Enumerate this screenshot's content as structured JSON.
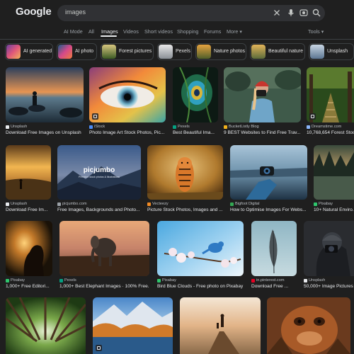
{
  "header": {
    "logo": "Google",
    "search_value": "images"
  },
  "tabs": [
    "AI Mode",
    "All",
    "Images",
    "Videos",
    "Short videos",
    "Shopping",
    "Forums",
    "More"
  ],
  "tools_label": "Tools",
  "chips": [
    "AI generated",
    "AI photo",
    "Forest pictures",
    "Pexels",
    "Nature photos",
    "Beautiful nature",
    "Unsplash"
  ],
  "results": [
    {
      "source": "Unsplash",
      "title": "Download Free Images on Unsplash"
    },
    {
      "source": "iStock",
      "title": "Photo Image Art Stock Photos, Pic..."
    },
    {
      "source": "Pexels",
      "title": "Best Beautiful Ima..."
    },
    {
      "source": "BucketListly Blog",
      "title": "9 BEST Websites to Find Free Trav..."
    },
    {
      "source": "Dreamstime.com",
      "title": "10,768,654 Forest Stock..."
    },
    {
      "source": "Unsplash",
      "title": "Download Free Im..."
    },
    {
      "source": "picjumbo.com",
      "title": "Free Images, Backgrounds and Photo..."
    },
    {
      "source": "Vecteezy",
      "title": "Picture Stock Photos, Images and ..."
    },
    {
      "source": "Bigfoot Digital",
      "title": "How to Optimise Images For Webs..."
    },
    {
      "source": "Pixabay",
      "title": "10+ Natural Enviro..."
    },
    {
      "source": "Pixabay",
      "title": "1,000+ Free Editori..."
    },
    {
      "source": "Pexels",
      "title": "1,000+ Best Elephant Images · 100% Free..."
    },
    {
      "source": "Pixabay",
      "title": "Bird Blue Clouds - Free photo on Pixabay"
    },
    {
      "source": "in.pinterest.com",
      "title": "Download Free ..."
    },
    {
      "source": "Unsplash",
      "title": "50,000+ Image Pictures ..."
    }
  ],
  "overlay_text": {
    "picjumbo_brand": "picjumbo",
    "picjumbo_sub": "Premium stock photos & illustrations"
  },
  "colors": {
    "background": "#1f1f1f",
    "search_bg": "#303134",
    "accent_text": "#e8eaed",
    "muted_text": "#9aa0a6"
  }
}
